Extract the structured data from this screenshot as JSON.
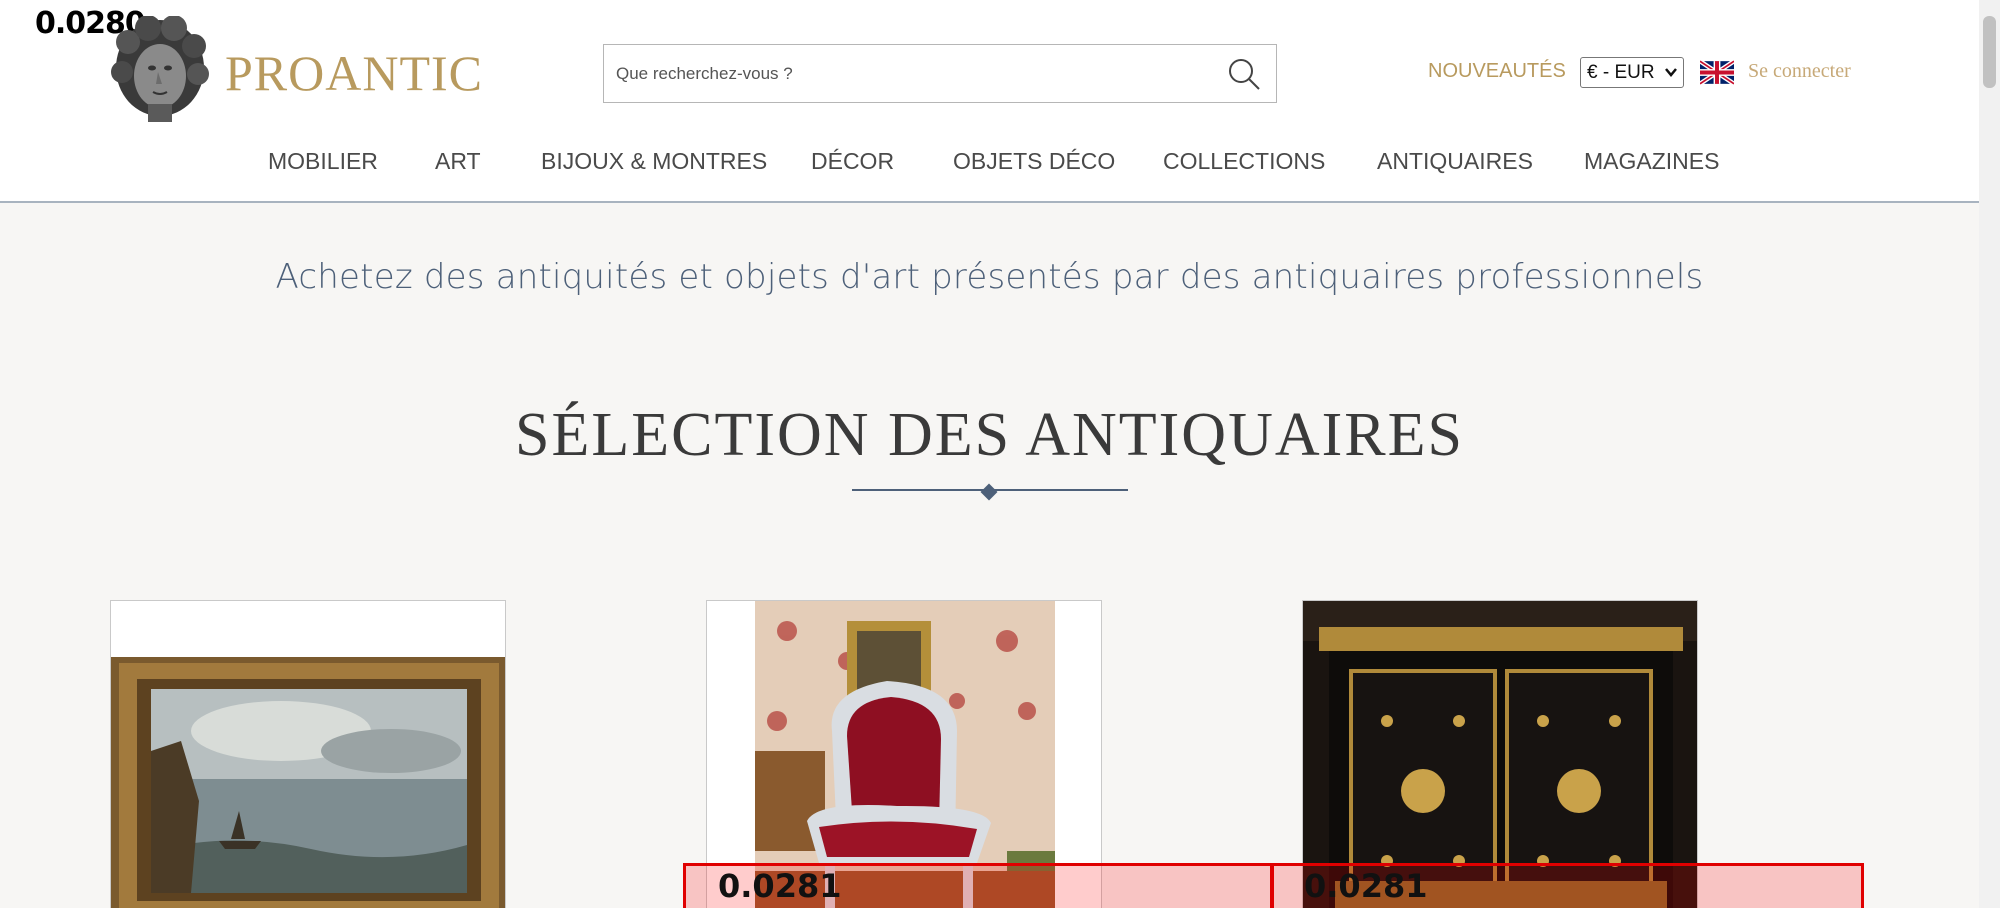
{
  "debug": {
    "top_score": "0.0280",
    "overlay_scores": [
      "0.0281",
      "0.0281"
    ]
  },
  "header": {
    "logo_text": "PROANTIC",
    "search_placeholder": "Que recherchez-vous ?",
    "nouveautes": "NOUVEAUTÉS",
    "currency": "€ - EUR",
    "login": "Se connecter"
  },
  "nav": [
    "MOBILIER",
    "ART",
    "BIJOUX & MONTRES",
    "DÉCOR",
    "OBJETS DÉCO",
    "COLLECTIONS",
    "ANTIQUAIRES",
    "MAGAZINES"
  ],
  "main": {
    "tagline": "Achetez des antiquités et objets d'art présentés par des antiquaires professionnels",
    "section_title": "SÉLECTION DES ANTIQUAIRES"
  },
  "colors": {
    "gold": "#b89a5e",
    "slate": "#4d6079",
    "background": "#f7f6f4"
  }
}
